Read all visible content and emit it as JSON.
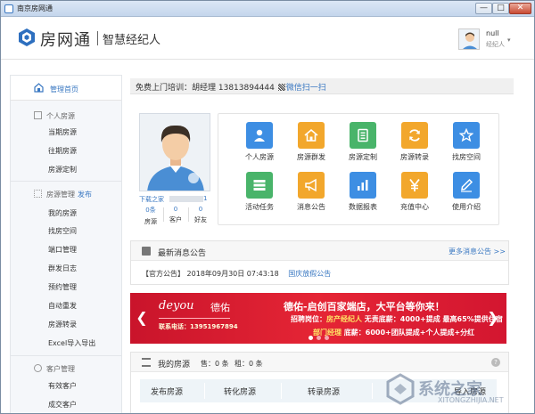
{
  "window": {
    "title": "南京房网通",
    "min": "—",
    "max": "□",
    "close": "✕"
  },
  "header": {
    "logo": "房网通",
    "subtitle": "智慧经纪人",
    "user_name": "null",
    "user_role": "经纪人",
    "caret": "▾"
  },
  "sidebar": {
    "home": "管理首页",
    "groups": [
      {
        "title": "个人房源",
        "icon": "document-icon",
        "items": [
          "当期房源",
          "往期房源",
          "房源定制"
        ]
      },
      {
        "title": "房源管理",
        "link": "发布",
        "icon": "grid-icon",
        "items": [
          "我的房源",
          "找房空间",
          "端口管理",
          "群发日志",
          "预约管理",
          "自动重发",
          "房源转录",
          "Excel导入导出"
        ]
      },
      {
        "title": "客户管理",
        "icon": "person-icon",
        "items": [
          "有效客户",
          "成交客户"
        ]
      }
    ]
  },
  "notice": {
    "text": "免费上门培训：胡经理 13813894444 ",
    "link": "微信扫一扫"
  },
  "profile": {
    "name_link": "下载之家",
    "count": "1",
    "stats": [
      {
        "num": "0条",
        "cap": "房源"
      },
      {
        "num": "0",
        "cap": "客户"
      },
      {
        "num": "0",
        "cap": "好友"
      }
    ]
  },
  "tiles": [
    {
      "label": "个人房源",
      "icon": "person-icon",
      "color": "#3d8ee3"
    },
    {
      "label": "房源群发",
      "icon": "house-icon",
      "color": "#f2a72c"
    },
    {
      "label": "房源定制",
      "icon": "document-icon",
      "color": "#49b46a"
    },
    {
      "label": "房源转录",
      "icon": "refresh-icon",
      "color": "#f2a72c"
    },
    {
      "label": "找房空间",
      "icon": "star-icon",
      "color": "#3d8ee3"
    },
    {
      "label": "活动任务",
      "icon": "list-icon",
      "color": "#49b46a"
    },
    {
      "label": "消息公告",
      "icon": "megaphone-icon",
      "color": "#f2a72c"
    },
    {
      "label": "数据报表",
      "icon": "bar-chart-icon",
      "color": "#3d8ee3"
    },
    {
      "label": "充值中心",
      "icon": "yen-icon",
      "color": "#f2a72c"
    },
    {
      "label": "使用介绍",
      "icon": "pencil-icon",
      "color": "#3d8ee3"
    }
  ],
  "news": {
    "title": "最新消息公告",
    "more": "更多消息公告 >>",
    "items": [
      {
        "tag": "【官方公告】",
        "date": "2018年09月30日 07:43:18",
        "title": "国庆放假公告"
      }
    ]
  },
  "banner": {
    "brand": "deyou",
    "brand_cn": "德佑",
    "phone": "联系电话：13951967894",
    "slogan": "德佑-启创百家端店，大平台等你来！",
    "job_label": "招聘岗位：",
    "job_title": "房产经纪人",
    "job_detail": "无责底薪：4000+提成 最高65%提供住宿",
    "job2_title": "部门经理",
    "job2_detail": "底薪：6000+团队提成+个人提成+分红"
  },
  "my_properties": {
    "title": "我的房源",
    "sale": "售：0 条",
    "rent": "租：0 条",
    "help": "?",
    "tabs": [
      "发布房源",
      "转化房源",
      "转录房源",
      "导入房源"
    ]
  },
  "watermark": {
    "text": "系统之家",
    "sub": "XITONGZHIJIA.NET"
  }
}
